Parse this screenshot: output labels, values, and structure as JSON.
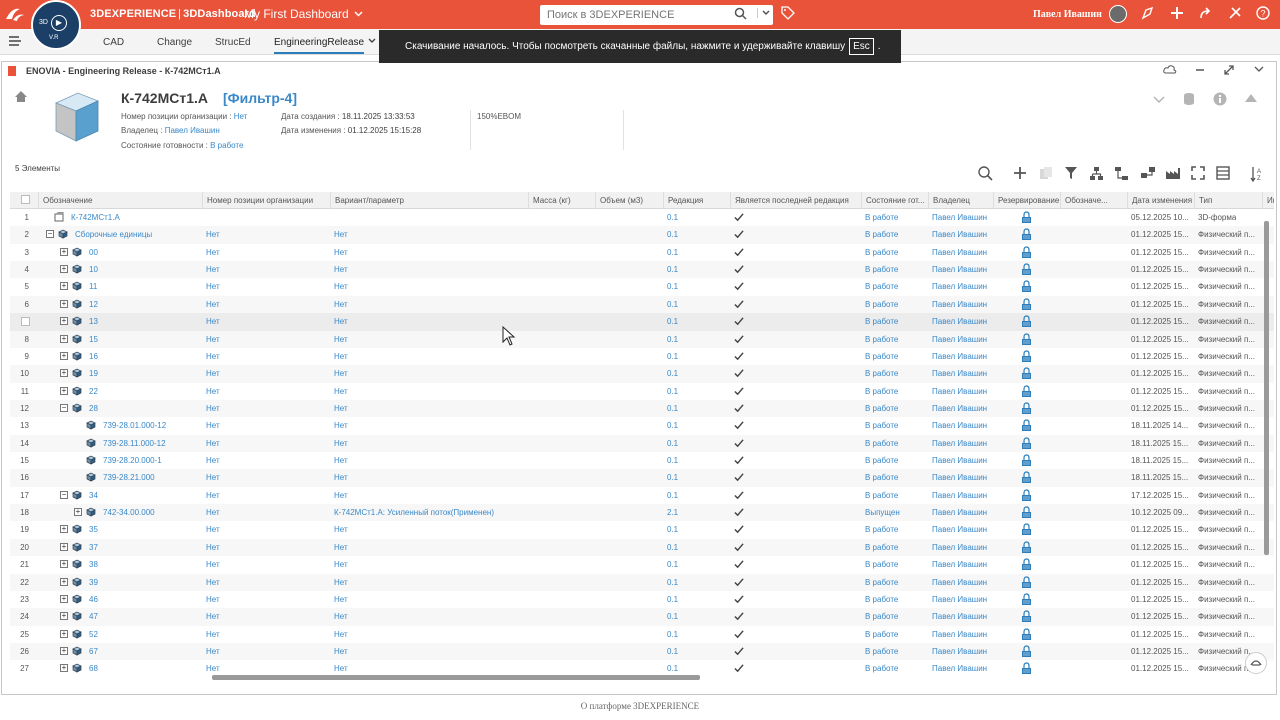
{
  "topbar": {
    "brand_3dx": "3DEXPERIENCE",
    "brand_sep": "|",
    "brand_dash": "3DDashboard",
    "dashboard_name": "My First Dashboard",
    "search_placeholder": "Поиск в 3DEXPERIENCE",
    "user_name": "Павел Ивашин",
    "compass_version": "V.R",
    "compass_3d": "3D"
  },
  "tabs": [
    "CAD",
    "Change",
    "StrucEd",
    "EngineeringRelease"
  ],
  "toast": {
    "text": "Скачивание началось. Чтобы посмотреть скачанные файлы, нажмите и удерживайте клавишу",
    "key": "Esc",
    "end": "."
  },
  "widget": {
    "title": "ENOVIA - Engineering Release - К-742МСт1.А"
  },
  "object": {
    "name": "К-742МСт1.А",
    "filter": "[Фильтр-4]",
    "org_pos_label": "Номер позиции организации :",
    "org_pos_value": "Нет",
    "owner_label": "Владелец :",
    "owner_value": "Павел Ивашин",
    "maturity_label": "Состояние готовности :",
    "maturity_value": "В работе",
    "created_label": "Дата создания :",
    "created_value": "18.11.2025 13:33:53",
    "modified_label": "Дата изменения :",
    "modified_value": "01.12.2025 15:15:28",
    "ebom": "150%EBOM"
  },
  "count": "5 Элементы",
  "columns": [
    "Обозначение",
    "Номер позиции организации",
    "Вариант/параметр",
    "Масса (кг)",
    "Объем (м3)",
    "Редакция",
    "Является последней редакция",
    "Состояние гот...",
    "Владелец",
    "Резервирование",
    "Обозначе...",
    "Дата изменения",
    "Тип",
    "Им"
  ],
  "rows": [
    {
      "n": "1",
      "title": "К-742МСт1.А",
      "org": "",
      "var": "",
      "rev": "0.1",
      "state": "В работе",
      "owner": "Павел Ивашин",
      "date": "05.12.2025 10...",
      "type": "3D-форма",
      "level": 0,
      "exp": ""
    },
    {
      "n": "2",
      "title": "Сборочные единицы",
      "org": "Нет",
      "var": "Нет",
      "rev": "0.1",
      "state": "В работе",
      "owner": "Павел Ивашин",
      "date": "01.12.2025 15...",
      "type": "Физический п...",
      "level": 1,
      "exp": "-"
    },
    {
      "n": "3",
      "title": "00",
      "org": "Нет",
      "var": "Нет",
      "rev": "0.1",
      "state": "В работе",
      "owner": "Павел Ивашин",
      "date": "01.12.2025 15...",
      "type": "Физический п...",
      "level": 2,
      "exp": "+"
    },
    {
      "n": "4",
      "title": "10",
      "org": "Нет",
      "var": "Нет",
      "rev": "0.1",
      "state": "В работе",
      "owner": "Павел Ивашин",
      "date": "01.12.2025 15...",
      "type": "Физический п...",
      "level": 2,
      "exp": "+"
    },
    {
      "n": "5",
      "title": "11",
      "org": "Нет",
      "var": "Нет",
      "rev": "0.1",
      "state": "В работе",
      "owner": "Павел Ивашин",
      "date": "01.12.2025 15...",
      "type": "Физический п...",
      "level": 2,
      "exp": "+"
    },
    {
      "n": "6",
      "title": "12",
      "org": "Нет",
      "var": "Нет",
      "rev": "0.1",
      "state": "В работе",
      "owner": "Павел Ивашин",
      "date": "01.12.2025 15...",
      "type": "Физический п...",
      "level": 2,
      "exp": "+"
    },
    {
      "n": "",
      "title": "13",
      "org": "Нет",
      "var": "Нет",
      "rev": "0.1",
      "state": "В работе",
      "owner": "Павел Ивашин",
      "date": "01.12.2025 15...",
      "type": "Физический п...",
      "level": 2,
      "exp": "+"
    },
    {
      "n": "8",
      "title": "15",
      "org": "Нет",
      "var": "Нет",
      "rev": "0.1",
      "state": "В работе",
      "owner": "Павел Ивашин",
      "date": "01.12.2025 15...",
      "type": "Физический п...",
      "level": 2,
      "exp": "+"
    },
    {
      "n": "9",
      "title": "16",
      "org": "Нет",
      "var": "Нет",
      "rev": "0.1",
      "state": "В работе",
      "owner": "Павел Ивашин",
      "date": "01.12.2025 15...",
      "type": "Физический п...",
      "level": 2,
      "exp": "+"
    },
    {
      "n": "10",
      "title": "19",
      "org": "Нет",
      "var": "Нет",
      "rev": "0.1",
      "state": "В работе",
      "owner": "Павел Ивашин",
      "date": "01.12.2025 15...",
      "type": "Физический п...",
      "level": 2,
      "exp": "+"
    },
    {
      "n": "11",
      "title": "22",
      "org": "Нет",
      "var": "Нет",
      "rev": "0.1",
      "state": "В работе",
      "owner": "Павел Ивашин",
      "date": "01.12.2025 15...",
      "type": "Физический п...",
      "level": 2,
      "exp": "+"
    },
    {
      "n": "12",
      "title": "28",
      "org": "Нет",
      "var": "Нет",
      "rev": "0.1",
      "state": "В работе",
      "owner": "Павел Ивашин",
      "date": "01.12.2025 15...",
      "type": "Физический п...",
      "level": 2,
      "exp": "-"
    },
    {
      "n": "13",
      "title": "739-28.01.000-12",
      "org": "Нет",
      "var": "Нет",
      "rev": "0.1",
      "state": "В работе",
      "owner": "Павел Ивашин",
      "date": "18.11.2025 14...",
      "type": "Физический п...",
      "level": 3,
      "exp": ""
    },
    {
      "n": "14",
      "title": "739-28.11.000-12",
      "org": "Нет",
      "var": "Нет",
      "rev": "0.1",
      "state": "В работе",
      "owner": "Павел Ивашин",
      "date": "18.11.2025 15...",
      "type": "Физический п...",
      "level": 3,
      "exp": ""
    },
    {
      "n": "15",
      "title": "739-28.20.000-1",
      "org": "Нет",
      "var": "Нет",
      "rev": "0.1",
      "state": "В работе",
      "owner": "Павел Ивашин",
      "date": "18.11.2025 15...",
      "type": "Физический п...",
      "level": 3,
      "exp": ""
    },
    {
      "n": "16",
      "title": "739-28.21.000",
      "org": "Нет",
      "var": "Нет",
      "rev": "0.1",
      "state": "В работе",
      "owner": "Павел Ивашин",
      "date": "18.11.2025 15...",
      "type": "Физический п...",
      "level": 3,
      "exp": ""
    },
    {
      "n": "17",
      "title": "34",
      "org": "Нет",
      "var": "Нет",
      "rev": "0.1",
      "state": "В работе",
      "owner": "Павел Ивашин",
      "date": "17.12.2025 15...",
      "type": "Физический п...",
      "level": 2,
      "exp": "-"
    },
    {
      "n": "18",
      "title": "742-34.00.000",
      "org": "Нет",
      "var": "К-742МСт1.А: Усиленный поток(Применен)",
      "rev": "2.1",
      "state": "Выпущен",
      "owner": "Павел Ивашин",
      "date": "10.12.2025 09...",
      "type": "Физический п...",
      "level": 3,
      "exp": "+"
    },
    {
      "n": "19",
      "title": "35",
      "org": "Нет",
      "var": "Нет",
      "rev": "0.1",
      "state": "В работе",
      "owner": "Павел Ивашин",
      "date": "01.12.2025 15...",
      "type": "Физический п...",
      "level": 2,
      "exp": "+"
    },
    {
      "n": "20",
      "title": "37",
      "org": "Нет",
      "var": "Нет",
      "rev": "0.1",
      "state": "В работе",
      "owner": "Павел Ивашин",
      "date": "01.12.2025 15...",
      "type": "Физический п...",
      "level": 2,
      "exp": "+"
    },
    {
      "n": "21",
      "title": "38",
      "org": "Нет",
      "var": "Нет",
      "rev": "0.1",
      "state": "В работе",
      "owner": "Павел Ивашин",
      "date": "01.12.2025 15...",
      "type": "Физический п...",
      "level": 2,
      "exp": "+"
    },
    {
      "n": "22",
      "title": "39",
      "org": "Нет",
      "var": "Нет",
      "rev": "0.1",
      "state": "В работе",
      "owner": "Павел Ивашин",
      "date": "01.12.2025 15...",
      "type": "Физический п...",
      "level": 2,
      "exp": "+"
    },
    {
      "n": "23",
      "title": "46",
      "org": "Нет",
      "var": "Нет",
      "rev": "0.1",
      "state": "В работе",
      "owner": "Павел Ивашин",
      "date": "01.12.2025 15...",
      "type": "Физический п...",
      "level": 2,
      "exp": "+"
    },
    {
      "n": "24",
      "title": "47",
      "org": "Нет",
      "var": "Нет",
      "rev": "0.1",
      "state": "В работе",
      "owner": "Павел Ивашин",
      "date": "01.12.2025 15...",
      "type": "Физический п...",
      "level": 2,
      "exp": "+"
    },
    {
      "n": "25",
      "title": "52",
      "org": "Нет",
      "var": "Нет",
      "rev": "0.1",
      "state": "В работе",
      "owner": "Павел Ивашин",
      "date": "01.12.2025 15...",
      "type": "Физический п...",
      "level": 2,
      "exp": "+"
    },
    {
      "n": "26",
      "title": "67",
      "org": "Нет",
      "var": "Нет",
      "rev": "0.1",
      "state": "В работе",
      "owner": "Павел Ивашин",
      "date": "01.12.2025 15...",
      "type": "Физический п...",
      "level": 2,
      "exp": "+"
    },
    {
      "n": "27",
      "title": "68",
      "org": "Нет",
      "var": "Нет",
      "rev": "0.1",
      "state": "В работе",
      "owner": "Павел Ивашин",
      "date": "01.12.2025 15...",
      "type": "Физический п...",
      "level": 2,
      "exp": "+"
    }
  ],
  "footer": "О платформе 3DEXPERIENCE",
  "colors": {
    "accent": "#e8533a",
    "link": "#3a88c8",
    "compass": "#1b3f66"
  }
}
